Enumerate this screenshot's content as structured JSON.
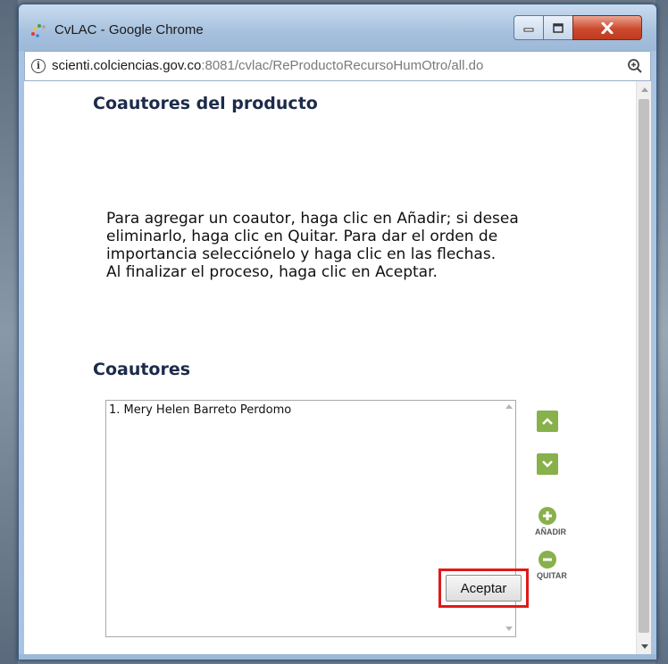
{
  "window": {
    "title": "CvLAC - Google Chrome"
  },
  "address_bar": {
    "host": "scienti.colciencias.gov.co",
    "path": ":8081/cvlac/ReProductoRecursoHumOtro/all.do"
  },
  "page": {
    "heading": "Coautores del producto",
    "instructions": "Para agregar un coautor, haga clic en Añadir; si desea\neliminarlo, haga clic en Quitar. Para dar el orden de\nimportancia selecciónelo y haga clic en las flechas.\nAl finalizar el proceso, haga clic en Aceptar.",
    "coauthors_heading": "Coautores",
    "coauthors": [
      "1. Mery Helen Barreto Perdomo"
    ],
    "add_label": "AÑADIR",
    "remove_label": "QUITAR",
    "accept_label": "Aceptar"
  },
  "colors": {
    "accent_green": "#88b04b",
    "highlight_red": "#e01919",
    "heading_navy": "#1c2b4a"
  },
  "icons": [
    "chrome-loading-icon",
    "minimize-icon",
    "maximize-icon",
    "close-icon",
    "info-icon",
    "zoom-icon",
    "arrow-up-icon",
    "arrow-down-icon",
    "add-circle-icon",
    "remove-circle-icon"
  ]
}
